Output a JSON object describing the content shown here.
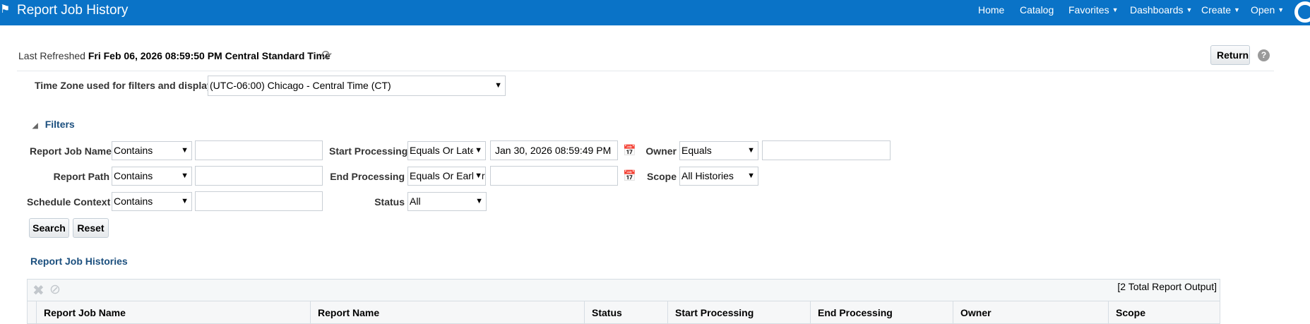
{
  "header": {
    "title": "Report Job History",
    "nav": [
      {
        "label": "Home",
        "caret": false
      },
      {
        "label": "Catalog",
        "caret": false
      },
      {
        "label": "Favorites",
        "caret": true
      },
      {
        "label": "Dashboards",
        "caret": true
      },
      {
        "label": "Create",
        "caret": true
      },
      {
        "label": "Open",
        "caret": true
      }
    ]
  },
  "refresh": {
    "prefix": "Last Refreshed",
    "timestamp": "Fri Feb 06, 2026 08:59:50 PM Central Standard Time"
  },
  "buttons": {
    "return": "Return",
    "help": "?",
    "search": "Search",
    "reset": "Reset"
  },
  "timezone": {
    "label": "Time Zone used for filters and display",
    "value": "(UTC-06:00) Chicago - Central Time (CT)"
  },
  "filters": {
    "title": "Filters",
    "job_name": {
      "label": "Report Job Name",
      "operator": "Contains",
      "value": ""
    },
    "report_path": {
      "label": "Report Path",
      "operator": "Contains",
      "value": ""
    },
    "schedule_context": {
      "label": "Schedule Context",
      "operator": "Contains",
      "value": ""
    },
    "start_processing": {
      "label": "Start Processing",
      "operator": "Equals Or Later",
      "value": "Jan 30, 2026 08:59:49 PM"
    },
    "end_processing": {
      "label": "End Processing",
      "operator": "Equals Or Earlier",
      "value": ""
    },
    "status": {
      "label": "Status",
      "value": "All"
    },
    "owner": {
      "label": "Owner",
      "operator": "Equals",
      "value": ""
    },
    "scope": {
      "label": "Scope",
      "value": "All Histories"
    }
  },
  "results": {
    "title": "Report Job Histories",
    "total": "[2 Total Report Output]",
    "columns": [
      "Report Job Name",
      "Report Name",
      "Status",
      "Start Processing",
      "End Processing",
      "Owner",
      "Scope"
    ]
  },
  "colors": {
    "header_bg": "#0a73c7",
    "section_title": "#1b4f7e"
  }
}
